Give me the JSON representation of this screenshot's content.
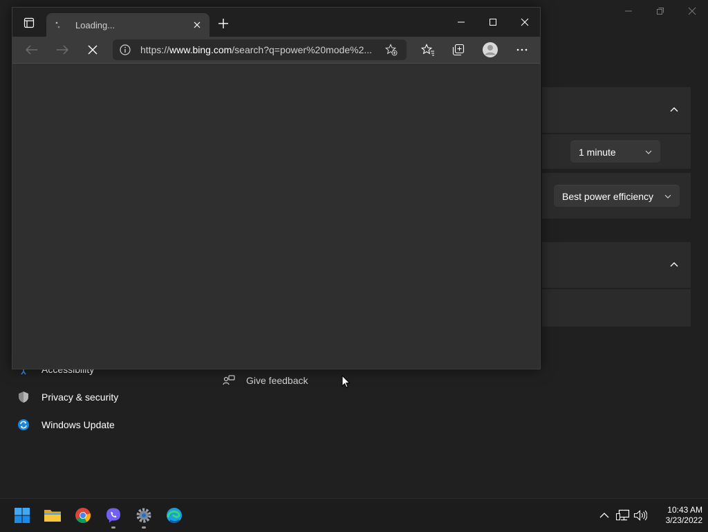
{
  "settings": {
    "screen_timeout": {
      "value": "1 minute"
    },
    "power_mode": {
      "value": "Best power efficiency"
    },
    "nav": [
      {
        "label": "Accessibility",
        "icon": "person-icon"
      },
      {
        "label": "Privacy & security",
        "icon": "shield-icon"
      },
      {
        "label": "Windows Update",
        "icon": "sync-icon"
      }
    ],
    "give_feedback": "Give feedback"
  },
  "edge": {
    "tab": {
      "title": "Loading...",
      "state": "loading"
    },
    "address": {
      "url_prefix": "https://",
      "url_host": "www.bing.com",
      "url_path": "/search?q=power%20mode%2..."
    }
  },
  "taskbar": {
    "apps": [
      "start-icon",
      "file-explorer-icon",
      "chrome-icon",
      "viber-icon",
      "settings-icon",
      "edge-icon"
    ],
    "clock": {
      "time": "10:43 AM",
      "date": "3/23/2022"
    }
  },
  "colors": {
    "background": "#202020",
    "card": "#2b2b2b",
    "edge_toolbar": "#3b3b3b",
    "windows_blue": "#0078d4"
  }
}
